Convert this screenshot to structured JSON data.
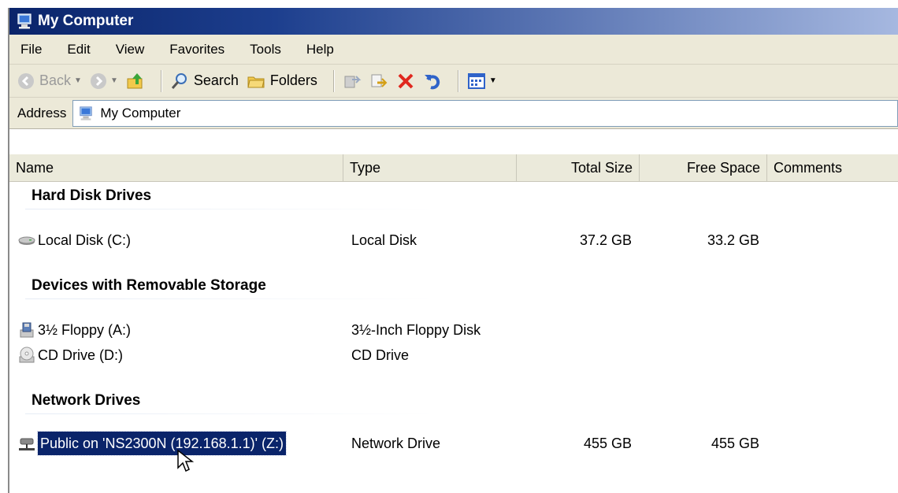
{
  "window": {
    "title": "My Computer"
  },
  "menu": [
    "File",
    "Edit",
    "View",
    "Favorites",
    "Tools",
    "Help"
  ],
  "toolbar": {
    "back": "Back",
    "search": "Search",
    "folders": "Folders"
  },
  "address": {
    "label": "Address",
    "value": "My Computer"
  },
  "columns": [
    "Name",
    "Type",
    "Total Size",
    "Free Space",
    "Comments"
  ],
  "groups": [
    {
      "title": "Hard Disk Drives",
      "items": [
        {
          "icon": "hard-disk-icon",
          "name": "Local Disk (C:)",
          "type": "Local Disk",
          "total": "37.2 GB",
          "free": "33.2 GB"
        }
      ]
    },
    {
      "title": "Devices with Removable Storage",
      "items": [
        {
          "icon": "floppy-drive-icon",
          "name": "3½ Floppy (A:)",
          "type": "3½-Inch Floppy Disk",
          "total": "",
          "free": ""
        },
        {
          "icon": "cd-drive-icon",
          "name": "CD Drive (D:)",
          "type": "CD Drive",
          "total": "",
          "free": ""
        }
      ]
    },
    {
      "title": "Network Drives",
      "items": [
        {
          "icon": "network-drive-icon",
          "name": "Public on 'NS2300N (192.168.1.1)' (Z:)",
          "type": "Network Drive",
          "total": "455 GB",
          "free": "455 GB",
          "selected": true
        }
      ]
    }
  ]
}
